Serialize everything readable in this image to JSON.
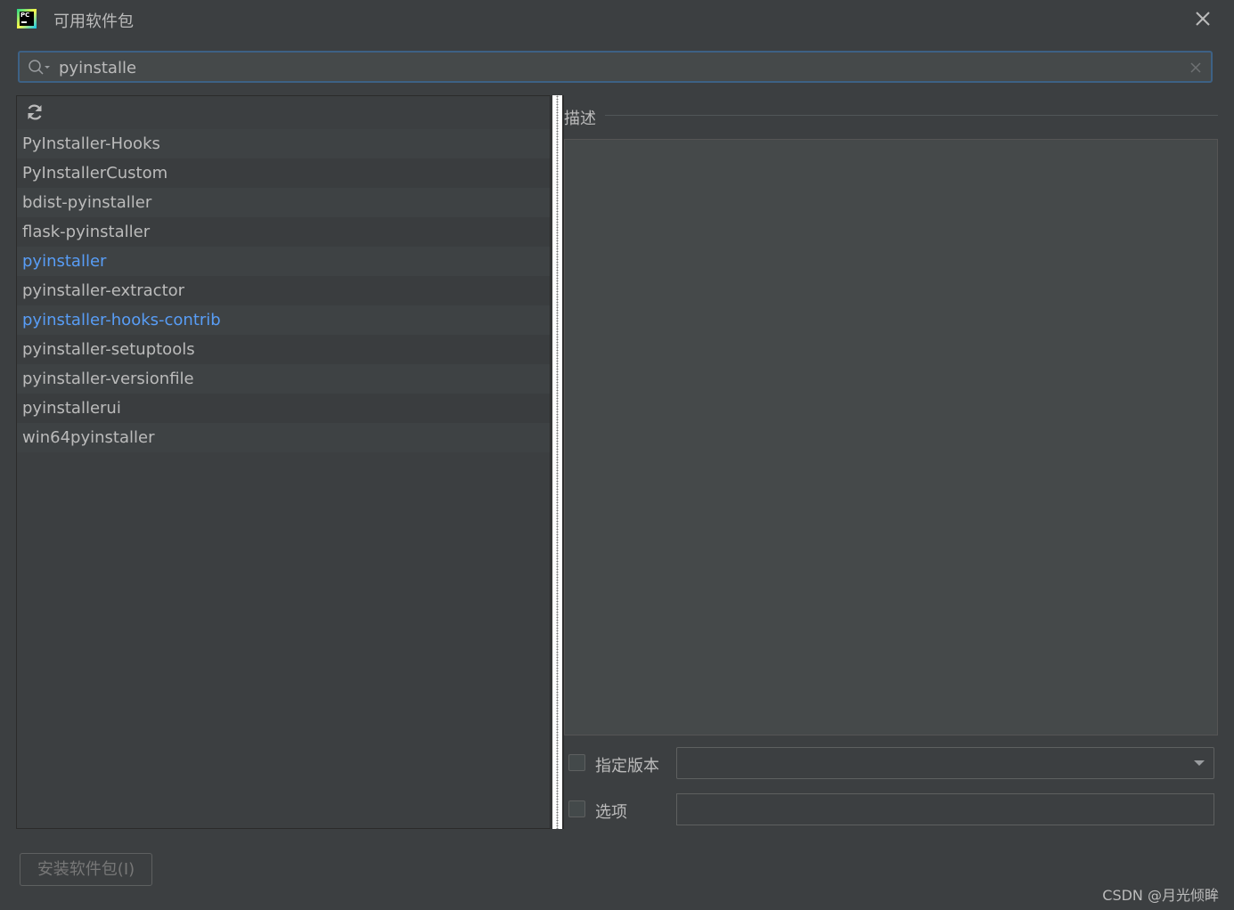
{
  "window": {
    "title": "可用软件包"
  },
  "search": {
    "value": "pyinstalle"
  },
  "packages": [
    {
      "name": "PyInstaller-Hooks",
      "installed": false
    },
    {
      "name": "PyInstallerCustom",
      "installed": false
    },
    {
      "name": "bdist-pyinstaller",
      "installed": false
    },
    {
      "name": "flask-pyinstaller",
      "installed": false
    },
    {
      "name": "pyinstaller",
      "installed": true
    },
    {
      "name": "pyinstaller-extractor",
      "installed": false
    },
    {
      "name": "pyinstaller-hooks-contrib",
      "installed": true
    },
    {
      "name": "pyinstaller-setuptools",
      "installed": false
    },
    {
      "name": "pyinstaller-versionfile",
      "installed": false
    },
    {
      "name": "pyinstallerui",
      "installed": false
    },
    {
      "name": "win64pyinstaller",
      "installed": false
    }
  ],
  "details": {
    "description_label": "描述",
    "version_label": "指定版本",
    "version_checked": false,
    "version_value": "",
    "options_label": "选项",
    "options_checked": false,
    "options_value": ""
  },
  "footer": {
    "install_label": "安装软件包(I)",
    "watermark": "CSDN @月光倾眸"
  },
  "colors": {
    "background": "#3c3f41",
    "text": "#bbbbbb",
    "installed_link": "#589df6",
    "focus_border": "#3d6185"
  },
  "icons": {
    "app": "pycharm-logo-icon",
    "close": "close-icon",
    "search": "search-icon",
    "clear": "clear-icon",
    "refresh": "refresh-icon",
    "dropdown": "chevron-down-icon"
  }
}
